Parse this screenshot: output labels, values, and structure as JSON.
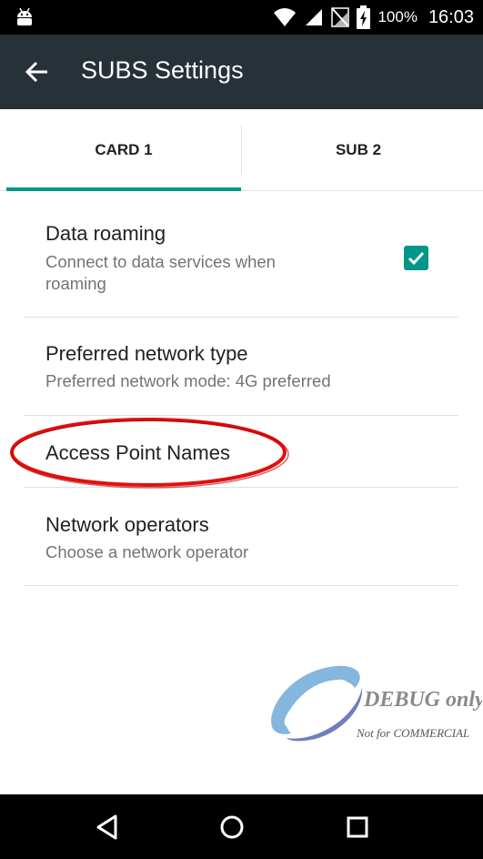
{
  "status_bar": {
    "battery_percent": "100%",
    "time": "16:03",
    "icons": [
      "android-icon",
      "wifi-icon",
      "signal-icon",
      "no-signal-icon",
      "battery-charging-icon"
    ]
  },
  "toolbar": {
    "title": "SUBS Settings",
    "back_icon": "arrow-back-icon"
  },
  "tabs": [
    {
      "label": "CARD 1",
      "selected": true
    },
    {
      "label": "SUB 2",
      "selected": false
    }
  ],
  "settings": [
    {
      "title": "Data roaming",
      "summary": "Connect to data services when roaming",
      "summary_lines": [
        "Connect to data services when",
        "roaming"
      ],
      "checked": true
    },
    {
      "title": "Preferred network type",
      "summary": "Preferred network mode: 4G preferred"
    },
    {
      "title": "Access Point Names",
      "highlighted": true
    },
    {
      "title": "Network operators",
      "summary": "Choose a network operator"
    }
  ],
  "watermark": {
    "line1": "DEBUG only",
    "line2": "Not for COMMERCIAL"
  },
  "nav_bar": [
    "back-triangle-icon",
    "home-circle-icon",
    "recents-square-icon"
  ],
  "colors": {
    "toolbar": "#263238",
    "accent": "#009688",
    "highlight_oval": "#d60000"
  }
}
